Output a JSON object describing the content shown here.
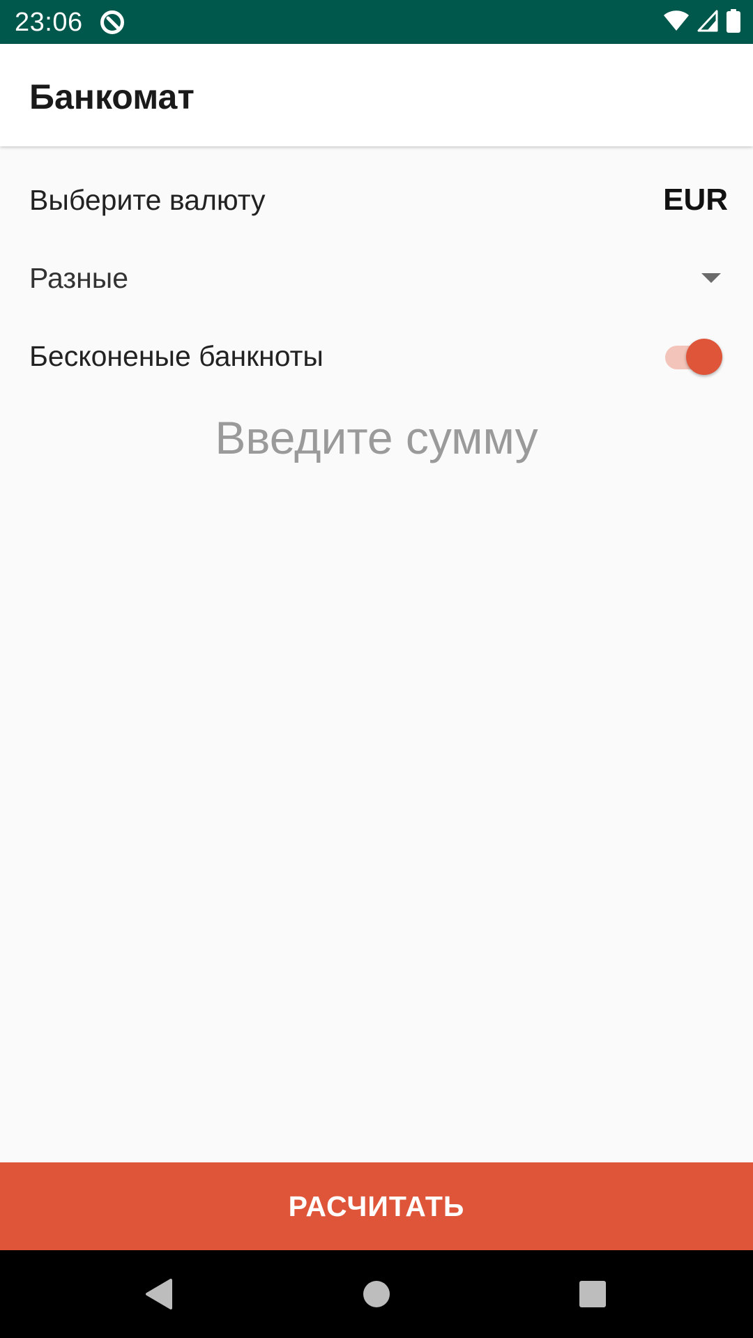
{
  "status_bar": {
    "time": "23:06",
    "icons": [
      "q-notification-icon",
      "wifi-icon",
      "signal-icon",
      "battery-icon"
    ],
    "background": "#00574b"
  },
  "app_bar": {
    "title": "Банкомат"
  },
  "currency_row": {
    "label": "Выберите валюту",
    "value": "EUR"
  },
  "banknote_spinner": {
    "selected": "Разные",
    "icon": "dropdown-arrow-icon"
  },
  "infinite_switch": {
    "label": "Бесконеные банкноты",
    "checked": true,
    "thumb_color": "#de5539",
    "track_color": "#f3c4b9"
  },
  "amount_field": {
    "value": "",
    "placeholder": "Введите сумму"
  },
  "calculate_button": {
    "label": "РАСЧИТАТЬ",
    "color": "#de5539"
  },
  "nav_bar": {
    "buttons": [
      "back-icon",
      "home-icon",
      "recents-icon"
    ]
  }
}
